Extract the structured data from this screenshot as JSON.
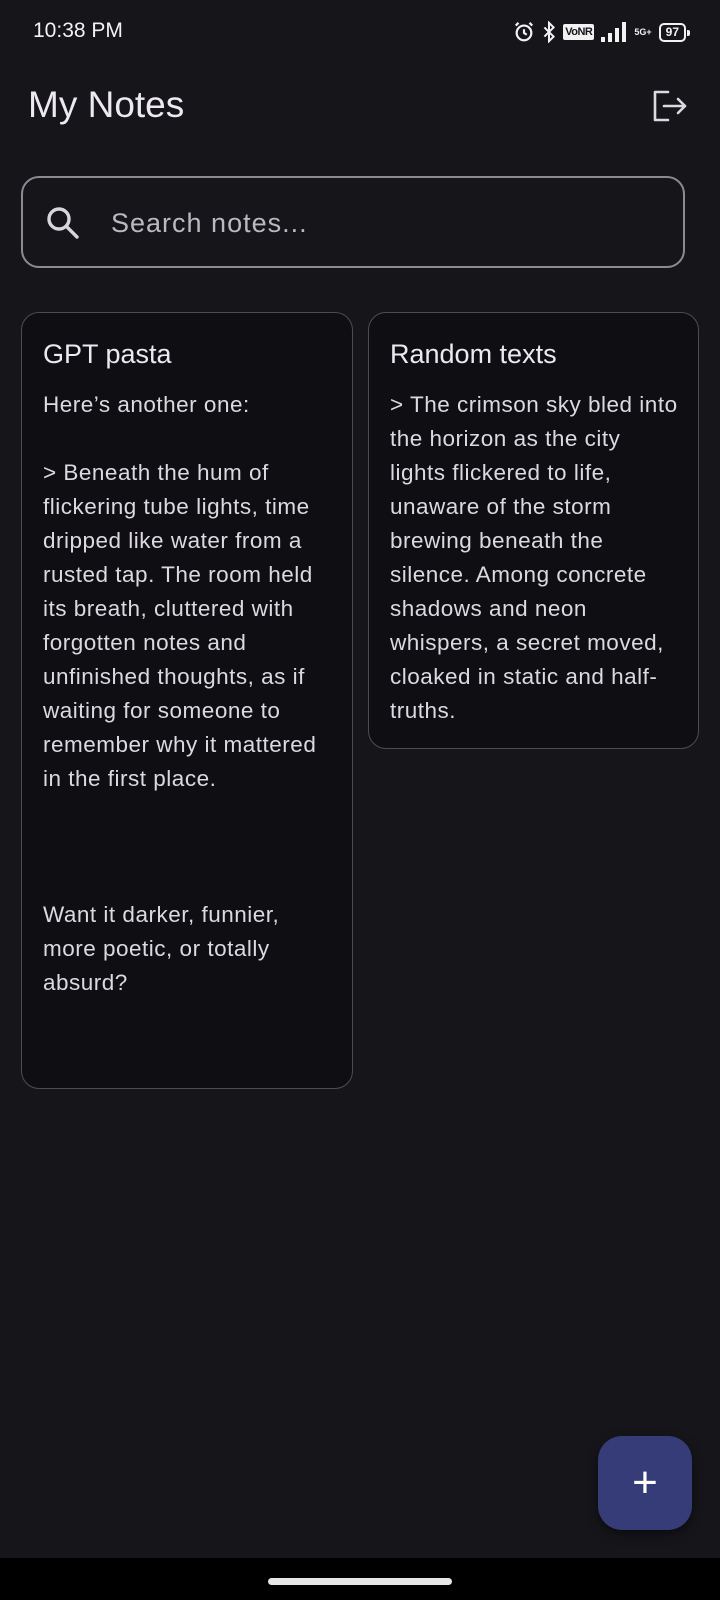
{
  "status_bar": {
    "time": "10:38 PM",
    "network_label": "VoNR",
    "network_gen": "5G+",
    "battery": "97"
  },
  "header": {
    "title": "My Notes",
    "logout_icon": "logout-icon"
  },
  "search": {
    "placeholder": "Search notes...",
    "value": "",
    "icon": "search-icon"
  },
  "notes": [
    {
      "title": "GPT pasta",
      "body": "Here’s another one:\n\n> Beneath the hum of flickering tube lights, time dripped like water from a rusted tap. The room held its breath, cluttered with forgotten notes and unfinished thoughts, as if waiting for someone to remember why it mattered in the first place.\n\n\n\nWant it darker, funnier, more poetic, or totally absurd?"
    },
    {
      "title": "Random texts",
      "body": "> The crimson sky bled into the horizon as the city lights flickered to life, unaware of the storm brewing beneath the silence. Among concrete shadows and neon whispers, a secret moved, cloaked in static and half-truths."
    }
  ],
  "fab": {
    "label": "+",
    "icon": "add-icon"
  },
  "colors": {
    "background": "#16151a",
    "card": "#0f0f13",
    "fab": "#363c78"
  }
}
